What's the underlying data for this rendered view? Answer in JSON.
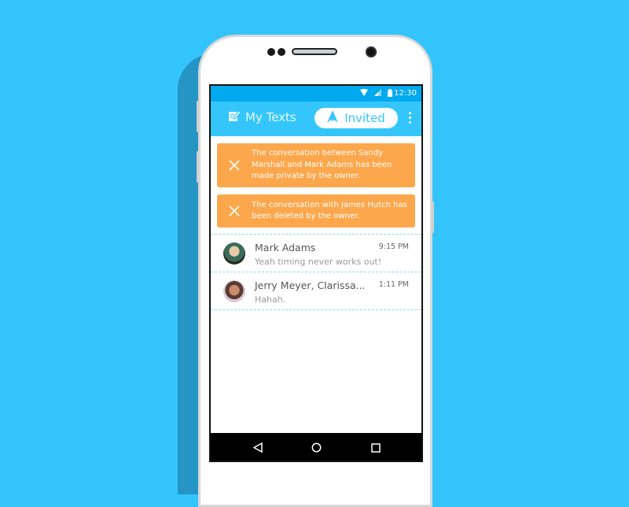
{
  "status_bar": {
    "time": "12:30",
    "icons": [
      "wifi-icon",
      "signal-icon",
      "battery-icon"
    ]
  },
  "app_bar": {
    "tabs": [
      {
        "label": "My Texts",
        "icon": "compose-icon",
        "active": false
      },
      {
        "label": "Invited",
        "icon": "invited-logo-icon",
        "active": true
      }
    ],
    "menu_icon": "more-vert-icon"
  },
  "alerts": [
    {
      "icon": "close-icon",
      "text": "The conversation between Sandy Marshall and Mark Adams has been made private by the owner."
    },
    {
      "icon": "close-icon",
      "text": "The conversation with James Hutch has been deleted by the owner."
    }
  ],
  "conversations": [
    {
      "name": "Mark Adams",
      "preview": "Yeah timing never works out!",
      "time": "9:15 PM"
    },
    {
      "name": "Jerry Meyer, Clarissa...",
      "preview": "Hahah.",
      "time": "1:11 PM"
    }
  ],
  "nav_bar": {
    "icons": [
      "back-icon",
      "home-icon",
      "recents-icon"
    ]
  },
  "colors": {
    "background": "#33c4fb",
    "app_bar": "#34c6fb",
    "status_bar": "#01a9ef",
    "alert": "#fda74c",
    "divider": "#8bd9fb"
  }
}
